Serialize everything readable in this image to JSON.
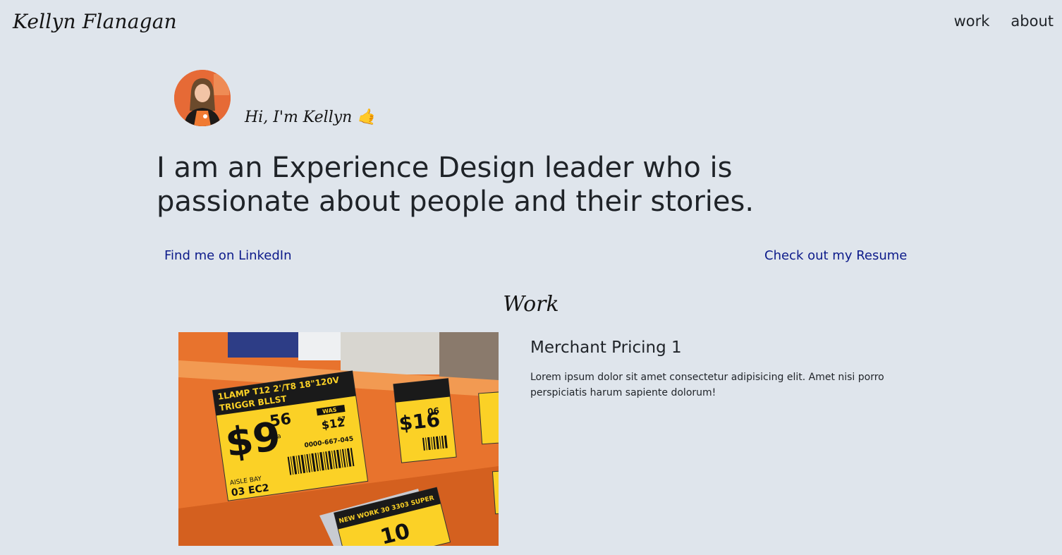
{
  "header": {
    "brand": "Kellyn Flanagan",
    "nav": {
      "work_label": "work",
      "about_label": "about"
    }
  },
  "intro": {
    "greeting": "Hi, I'm Kellyn 🤙",
    "headline": "I am an Experience Design leader who is passionate about people and their stories."
  },
  "links": {
    "linkedin": "Find me on LinkedIn",
    "resume": "Check out my Resume"
  },
  "work": {
    "section_title": "Work",
    "projects": [
      {
        "title": "Merchant Pricing 1",
        "description": "Lorem ipsum dolor sit amet consectetur adipisicing elit. Amet nisi porro perspiciatis harum sapiente dolorum!"
      }
    ]
  },
  "colors": {
    "background": "#dfe5ec",
    "link": "#0c1a8a",
    "text": "#1f2328"
  },
  "image_text": {
    "label_main_title": "1LAMP T12 2'/T8 18\"120V",
    "label_main_sub": "TRIGGR BLLST",
    "label_main_price_dollars": "$9",
    "label_main_price_cents": "56",
    "label_main_ea": "ea",
    "label_main_was": "WAS",
    "label_main_was_price": "$12",
    "label_main_was_cents": "57",
    "label_main_sku": "0000-667-045",
    "label_main_aisle": "AISLE  BAY",
    "label_main_aisle_code": "03  EC2",
    "label_mid_price": "$16",
    "label_mid_cents": "06",
    "label_bottom_title": "NEW WORK 30 3303 SUPER",
    "label_bottom_price": "10"
  }
}
